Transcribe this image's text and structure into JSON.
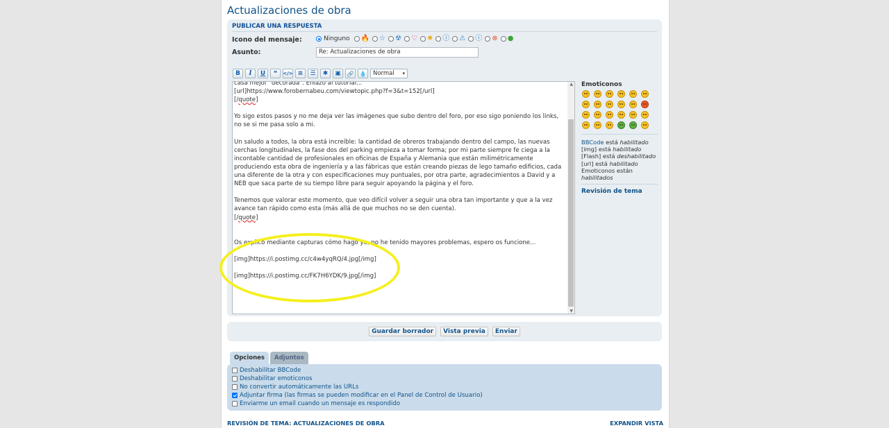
{
  "page_title": "Actualizaciones de obra",
  "panel_header": "PUBLICAR UNA RESPUESTA",
  "icon_label": "Icono del mensaje:",
  "icon_none_label": "Ninguno",
  "icon_options": [
    "fire-icon",
    "star-icon",
    "radioactive-icon",
    "heart-icon",
    "star-burst-icon",
    "question-icon",
    "warning-icon",
    "info-icon",
    "error-icon",
    "thumbs-up-icon"
  ],
  "subject_label": "Asunto:",
  "subject_value": "Re: Actualizaciones de obra",
  "toolbar": {
    "bold": "B",
    "italic": "I",
    "underline": "U",
    "quote": "❝",
    "code": "</>",
    "list": "≡",
    "olist": "☰",
    "list_item": "✱",
    "image": "▣",
    "link": "🔗",
    "flash": "💧",
    "size_select": "Normal"
  },
  "message": {
    "l1": "casa mejor \"decorada\". Enlazo al tutorial...",
    "l2": "[url]https://www.forobernabeu.com/viewtopic.php?f=3&t=152[/url]",
    "l3a": "[/",
    "l3b": "quote",
    "l3c": "]",
    "l4": "Yo sigo estos pasos y no me deja ver las imágenes que subo dentro del foro, por eso sigo poniendo los links, no se si me pasa solo a mi.",
    "l5": "Un saludo a todos, la obra está increíble: la cantidad de obreros trabajando dentro del campo, las nuevas cerchas longitudinales, la fase dos del parking empieza a tomar forma; por mi parte siempre fe ciega a la incontable cantidad de profesionales en oficinas de España y Alemania que están milimétricamente produciendo esta obra de ingeniería y a las fábricas que están creando piezas de lego tamaño edificios, cada una diferente de la otra y con especificaciones muy puntuales, por otra parte, agradecimientos a David y a NEB que saca parte de su tiempo libre para seguir apoyando la página y el foro.",
    "l6": "Tenemos que valorar este momento, que veo difícil volver a seguir una obra tan importante y que a la vez avance tan rápido como esta (más allá de que muchos no se den cuenta).",
    "l7a": "[/",
    "l7b": "quote",
    "l7c": "]",
    "l8": "Os explico mediante capturas cómo hago yo, no he tenido mayores problemas, espero os funcione...",
    "l9": "[img]https://i.postimg.cc/c4w4yqRQ/4.jpg[/img]",
    "l10": "[img]https://i.postimg.cc/FK7H6YDK/9.jpg[/img]"
  },
  "side": {
    "emoticons_title": "Emoticonos",
    "bbcode_link": "BBCode",
    "bbcode_rest": " está ",
    "bbcode_state": "habilitado",
    "img_text": "[img] está ",
    "img_state": "habilitado",
    "flash_text": "[Flash] está ",
    "flash_state": "deshabilitado",
    "url_text": "[url] está ",
    "url_state": "habilitado",
    "emo_text": "Emoticonos están",
    "emo_state": "habilitados",
    "revision": "Revisión de tema"
  },
  "buttons": {
    "save_draft": "Guardar borrador",
    "preview": "Vista previa",
    "submit": "Enviar"
  },
  "tabs": {
    "options": "Opciones",
    "attachments": "Adjuntos"
  },
  "options": [
    {
      "label": "Deshabilitar BBCode",
      "checked": false
    },
    {
      "label": "Deshabilitar emoticonos",
      "checked": false
    },
    {
      "label": "No convertir automáticamente las URLs",
      "checked": false
    },
    {
      "label": "Adjuntar firma (las firmas se pueden modificar en el Panel de Control de Usuario)",
      "checked": true
    },
    {
      "label": "Enviarme un email cuando un mensaje es respondido",
      "checked": false
    }
  ],
  "footer": {
    "left": "REVISIÓN DE TEMA: ACTUALIZACIONES DE OBRA",
    "right": "EXPANDIR VISTA"
  },
  "colors": {
    "link": "#105289",
    "panel": "#e8eef2",
    "options_panel": "#cadceb",
    "highlight": "#f5ef1c"
  }
}
